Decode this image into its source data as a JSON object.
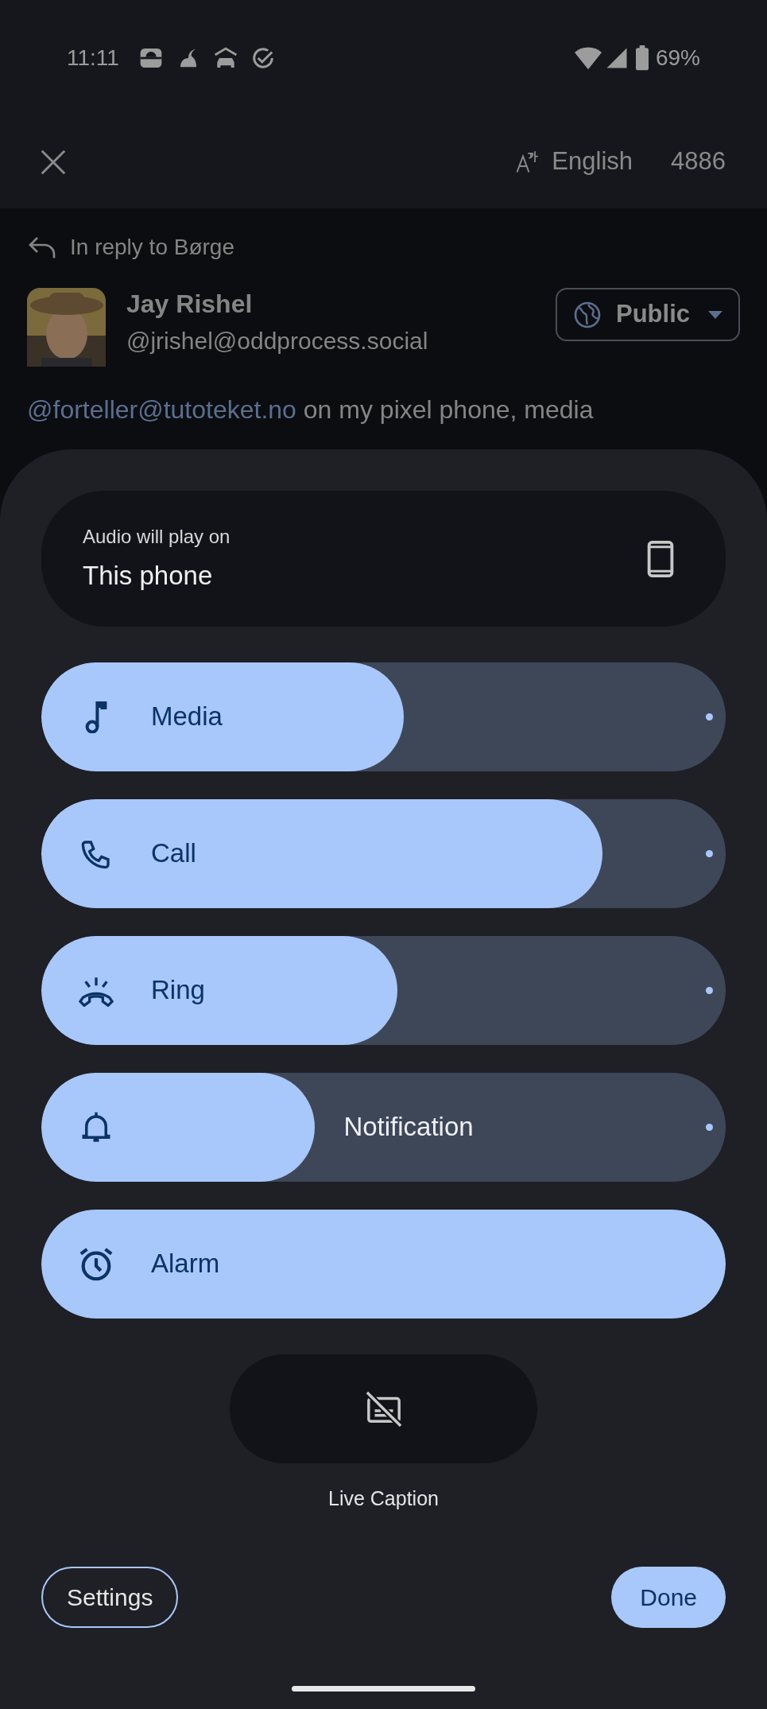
{
  "status_bar": {
    "time": "11:11",
    "battery": "69%"
  },
  "header": {
    "language": "English",
    "character_count": "4886"
  },
  "post": {
    "reply_to": "In reply to Børge",
    "author_name": "Jay Rishel",
    "author_handle": "@jrishel@oddprocess.social",
    "visibility": "Public",
    "mention": "@forteller@tutoteket.no",
    "text": " on my pixel phone, media"
  },
  "volume_panel": {
    "output": {
      "caption": "Audio will play on",
      "device": "This phone"
    },
    "sliders": [
      {
        "kind": "media",
        "label": "Media",
        "level": 0.53
      },
      {
        "kind": "call",
        "label": "Call",
        "level": 0.82
      },
      {
        "kind": "ring",
        "label": "Ring",
        "level": 0.52
      },
      {
        "kind": "notification",
        "label": "Notification",
        "level": 0.4
      },
      {
        "kind": "alarm",
        "label": "Alarm",
        "level": 1
      }
    ],
    "live_caption": {
      "label": "Live Caption",
      "on": false
    },
    "buttons": [
      {
        "kind": "outline",
        "label": "Settings"
      },
      {
        "kind": "filled",
        "label": "Done"
      }
    ]
  }
}
